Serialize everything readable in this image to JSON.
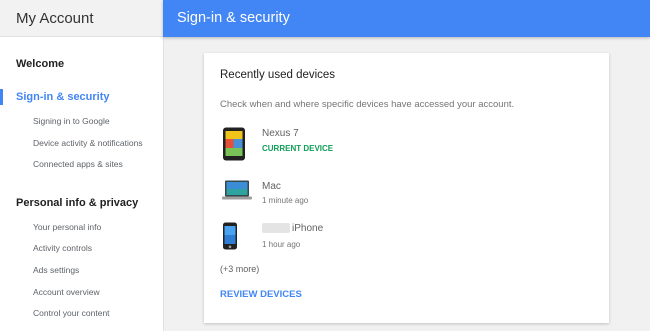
{
  "sidebar": {
    "title": "My Account",
    "sections": [
      {
        "label": "Welcome"
      },
      {
        "label": "Sign-in & security",
        "items": [
          "Signing in to Google",
          "Device activity & notifications",
          "Connected apps & sites"
        ]
      },
      {
        "label": "Personal info & privacy",
        "items": [
          "Your personal info",
          "Activity controls",
          "Ads settings",
          "Account overview",
          "Control your content"
        ]
      }
    ]
  },
  "header": {
    "title": "Sign-in & security"
  },
  "card": {
    "title": "Recently used devices",
    "description": "Check when and where specific devices have accessed your account.",
    "devices": [
      {
        "name": "Nexus 7",
        "status": "CURRENT DEVICE",
        "icon": "tablet-icon"
      },
      {
        "name": "Mac",
        "status": "1 minute ago",
        "icon": "laptop-icon"
      },
      {
        "name": "iPhone",
        "status": "1 hour ago",
        "icon": "phone-icon"
      }
    ],
    "more": "(+3 more)",
    "review_label": "REVIEW DEVICES"
  },
  "colors": {
    "accent": "#4285f4",
    "current_device": "#0f9d58"
  }
}
